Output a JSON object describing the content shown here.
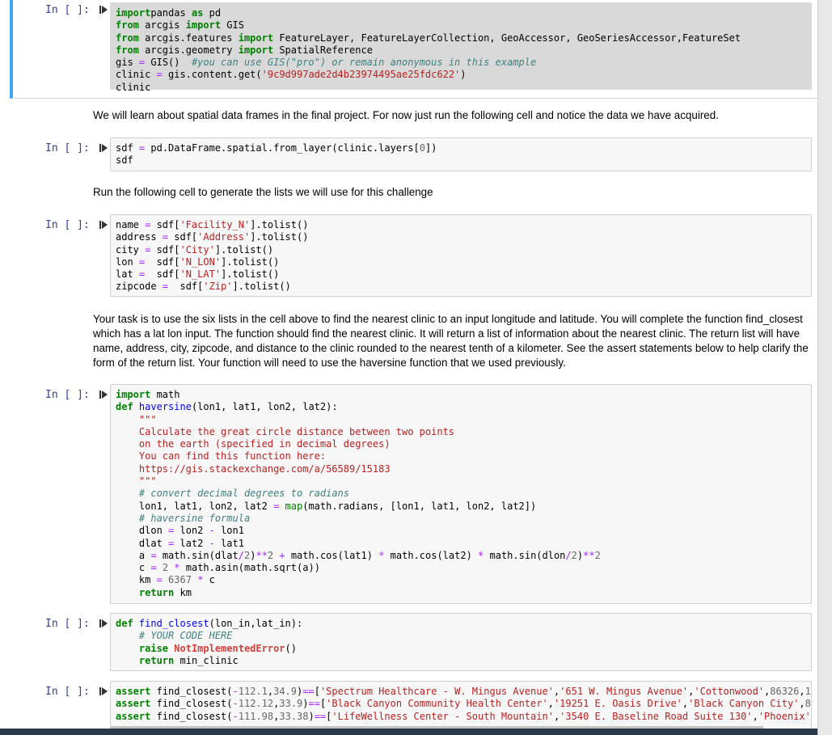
{
  "cells": [
    {
      "prompt": "In [ ]:",
      "lines": [
        [
          [
            "kw",
            "import"
          ],
          [
            "",
            "pandas "
          ],
          [
            "kw",
            "as"
          ],
          [
            "",
            " pd"
          ]
        ],
        [
          [
            "kw",
            "from"
          ],
          [
            "",
            " arcgis "
          ],
          [
            "kw",
            "import"
          ],
          [
            "",
            " GIS"
          ]
        ],
        [
          [
            "kw",
            "from"
          ],
          [
            "",
            " arcgis.features "
          ],
          [
            "kw",
            "import"
          ],
          [
            "",
            " FeatureLayer, FeatureLayerCollection, GeoAccessor, GeoSeriesAccessor,FeatureSet"
          ]
        ],
        [
          [
            "kw",
            "from"
          ],
          [
            "",
            " arcgis.geometry "
          ],
          [
            "kw",
            "import"
          ],
          [
            "",
            " SpatialReference"
          ]
        ],
        [
          [
            "",
            "gis "
          ],
          [
            "op",
            "="
          ],
          [
            "",
            " GIS()  "
          ],
          [
            "com",
            "#you can use GIS(\"pro\") or remain anonymous in this example"
          ]
        ],
        [
          [
            "",
            "clinic "
          ],
          [
            "op",
            "="
          ],
          [
            "",
            " gis.content.get("
          ],
          [
            "str",
            "'9c9d997ade2d4b23974495ae25fdc622'"
          ],
          [
            "",
            ")"
          ]
        ],
        [
          [
            "",
            "clinic"
          ]
        ]
      ]
    },
    {
      "prompt": "In [ ]:",
      "lines": [
        [
          [
            "",
            "sdf "
          ],
          [
            "op",
            "="
          ],
          [
            "",
            " pd.DataFrame.spatial.from_layer(clinic.layers["
          ],
          [
            "num",
            "0"
          ],
          [
            "",
            "])"
          ]
        ],
        [
          [
            "",
            "sdf"
          ]
        ]
      ]
    },
    {
      "prompt": "In [ ]:",
      "lines": [
        [
          [
            "",
            "name "
          ],
          [
            "op",
            "="
          ],
          [
            "",
            " sdf["
          ],
          [
            "str",
            "'Facility_N'"
          ],
          [
            "",
            "].tolist()"
          ]
        ],
        [
          [
            "",
            "address "
          ],
          [
            "op",
            "="
          ],
          [
            "",
            " sdf["
          ],
          [
            "str",
            "'Address'"
          ],
          [
            "",
            "].tolist()"
          ]
        ],
        [
          [
            "",
            "city "
          ],
          [
            "op",
            "="
          ],
          [
            "",
            " sdf["
          ],
          [
            "str",
            "'City'"
          ],
          [
            "",
            "].tolist()"
          ]
        ],
        [
          [
            "",
            "lon "
          ],
          [
            "op",
            "="
          ],
          [
            "",
            "  sdf["
          ],
          [
            "str",
            "'N_LON'"
          ],
          [
            "",
            "].tolist()"
          ]
        ],
        [
          [
            "",
            "lat "
          ],
          [
            "op",
            "="
          ],
          [
            "",
            "  sdf["
          ],
          [
            "str",
            "'N_LAT'"
          ],
          [
            "",
            "].tolist()"
          ]
        ],
        [
          [
            "",
            "zipcode "
          ],
          [
            "op",
            "="
          ],
          [
            "",
            "  sdf["
          ],
          [
            "str",
            "'Zip'"
          ],
          [
            "",
            "].tolist()"
          ]
        ]
      ]
    },
    {
      "prompt": "In [ ]:",
      "lines": [
        [
          [
            "kw",
            "import"
          ],
          [
            "",
            " math"
          ]
        ],
        [
          [
            "kw",
            "def"
          ],
          [
            "",
            " "
          ],
          [
            "fn",
            "haversine"
          ],
          [
            "",
            "(lon1, lat1, lon2, lat2):"
          ]
        ],
        [
          [
            "",
            "    "
          ],
          [
            "str",
            "\"\"\""
          ]
        ],
        [
          [
            "str",
            "    Calculate the great circle distance between two points"
          ]
        ],
        [
          [
            "str",
            "    on the earth (specified in decimal degrees)"
          ]
        ],
        [
          [
            "str",
            "    You can find this function here:"
          ]
        ],
        [
          [
            "str",
            "    https://gis.stackexchange.com/a/56589/15183"
          ]
        ],
        [
          [
            "str",
            "    \"\"\""
          ]
        ],
        [
          [
            "",
            "    "
          ],
          [
            "com",
            "# convert decimal degrees to radians"
          ]
        ],
        [
          [
            "",
            "    lon1, lat1, lon2, lat2 "
          ],
          [
            "op",
            "="
          ],
          [
            "",
            " "
          ],
          [
            "kw2",
            "map"
          ],
          [
            "",
            "(math.radians, [lon1, lat1, lon2, lat2])"
          ]
        ],
        [
          [
            "",
            "    "
          ],
          [
            "com",
            "# haversine formula"
          ]
        ],
        [
          [
            "",
            "    dlon "
          ],
          [
            "op",
            "="
          ],
          [
            "",
            " lon2 "
          ],
          [
            "op",
            "-"
          ],
          [
            "",
            " lon1"
          ]
        ],
        [
          [
            "",
            "    dlat "
          ],
          [
            "op",
            "="
          ],
          [
            "",
            " lat2 "
          ],
          [
            "op",
            "-"
          ],
          [
            "",
            " lat1"
          ]
        ],
        [
          [
            "",
            "    a "
          ],
          [
            "op",
            "="
          ],
          [
            "",
            " math.sin(dlat"
          ],
          [
            "op",
            "/"
          ],
          [
            "num",
            "2"
          ],
          [
            "",
            ")"
          ],
          [
            "op",
            "**"
          ],
          [
            "num",
            "2"
          ],
          [
            "",
            " "
          ],
          [
            "op",
            "+"
          ],
          [
            "",
            " math.cos(lat1) "
          ],
          [
            "op",
            "*"
          ],
          [
            "",
            " math.cos(lat2) "
          ],
          [
            "op",
            "*"
          ],
          [
            "",
            " math.sin(dlon"
          ],
          [
            "op",
            "/"
          ],
          [
            "num",
            "2"
          ],
          [
            "",
            ")"
          ],
          [
            "op",
            "**"
          ],
          [
            "num",
            "2"
          ]
        ],
        [
          [
            "",
            "    c "
          ],
          [
            "op",
            "="
          ],
          [
            "",
            " "
          ],
          [
            "num",
            "2"
          ],
          [
            "",
            " "
          ],
          [
            "op",
            "*"
          ],
          [
            "",
            " math.asin(math.sqrt(a))"
          ]
        ],
        [
          [
            "",
            "    km "
          ],
          [
            "op",
            "="
          ],
          [
            "",
            " "
          ],
          [
            "num",
            "6367"
          ],
          [
            "",
            " "
          ],
          [
            "op",
            "*"
          ],
          [
            "",
            " c"
          ]
        ],
        [
          [
            "",
            "    "
          ],
          [
            "kw",
            "return"
          ],
          [
            "",
            " km"
          ]
        ]
      ]
    },
    {
      "prompt": "In [ ]:",
      "lines": [
        [
          [
            "kw",
            "def"
          ],
          [
            "",
            " "
          ],
          [
            "fn",
            "find_closest"
          ],
          [
            "",
            "(lon_in,lat_in):"
          ]
        ],
        [
          [
            "",
            "    "
          ],
          [
            "com",
            "# YOUR CODE HERE"
          ]
        ],
        [
          [
            "",
            "    "
          ],
          [
            "kw",
            "raise"
          ],
          [
            "",
            " "
          ],
          [
            "err",
            "NotImplementedError"
          ],
          [
            "",
            "()"
          ]
        ],
        [
          [
            "",
            "    "
          ],
          [
            "kw",
            "return"
          ],
          [
            "",
            " min_clinic"
          ]
        ]
      ]
    },
    {
      "prompt": "In [ ]:",
      "lines": [
        [
          [
            "kw",
            "assert"
          ],
          [
            "",
            " find_closest("
          ],
          [
            "op",
            "-"
          ],
          [
            "num",
            "112.1"
          ],
          [
            "",
            ","
          ],
          [
            "num",
            "34.9"
          ],
          [
            "",
            ")"
          ],
          [
            "op",
            "=="
          ],
          [
            "",
            "["
          ],
          [
            "str",
            "'Spectrum Healthcare - W. Mingus Avenue'"
          ],
          [
            "",
            ","
          ],
          [
            "str",
            "'651 W. Mingus Avenue'"
          ],
          [
            "",
            ","
          ],
          [
            "str",
            "'Cottonwood'"
          ],
          [
            "",
            ","
          ],
          [
            "num",
            "86326"
          ],
          [
            "",
            ","
          ],
          [
            "num",
            "18.9"
          ],
          [
            "",
            "]"
          ]
        ],
        [
          [
            "kw",
            "assert"
          ],
          [
            "",
            " find_closest("
          ],
          [
            "op",
            "-"
          ],
          [
            "num",
            "112.12"
          ],
          [
            "",
            ","
          ],
          [
            "num",
            "33.9"
          ],
          [
            "",
            ")"
          ],
          [
            "op",
            "=="
          ],
          [
            "",
            "["
          ],
          [
            "str",
            "'Black Canyon Community Health Center'"
          ],
          [
            "",
            ","
          ],
          [
            "str",
            "'19251 E. Oasis Drive'"
          ],
          [
            "",
            ","
          ],
          [
            "str",
            "'Black Canyon City'"
          ],
          [
            "",
            ","
          ],
          [
            "num",
            "85324"
          ],
          [
            "",
            ",1"
          ]
        ],
        [
          [
            "kw",
            "assert"
          ],
          [
            "",
            " find_closest("
          ],
          [
            "op",
            "-"
          ],
          [
            "num",
            "111.98"
          ],
          [
            "",
            ","
          ],
          [
            "num",
            "33.38"
          ],
          [
            "",
            ")"
          ],
          [
            "op",
            "=="
          ],
          [
            "",
            "["
          ],
          [
            "str",
            "'LifeWellness Center - South Mountain'"
          ],
          [
            "",
            ","
          ],
          [
            "str",
            "'3540 E. Baseline Road Suite 130'"
          ],
          [
            "",
            ","
          ],
          [
            "str",
            "'Phoenix'"
          ],
          [
            "",
            ","
          ],
          [
            "num",
            "85042"
          ]
        ]
      ]
    }
  ],
  "markdown": {
    "m1": "We will learn about spatial data frames in the final project. For now just run the following cell and notice the data we have acquired.",
    "m2": "Run the following cell to generate the lists we will use for this challenge",
    "m3": "Your task is to use the six lists in the cell above to find the nearest clinic to an input longitude and latitude. You will complete the function find_closest which has a lat lon input. The function should find the nearest clinic. It will return a list of information about the nearest clinic. The return list will have name, address, city, zipcode, and distance to the clinic rounded to the nearest tenth of a kilometer. See the assert statements below to help clarify the form of the return list. Your function will need to use the haversine function that we used previously."
  },
  "icons": {
    "run": "run-cell-icon"
  },
  "colors": {
    "selected_cell_bar": "#42a5f5",
    "prompt": "#303f9f"
  }
}
